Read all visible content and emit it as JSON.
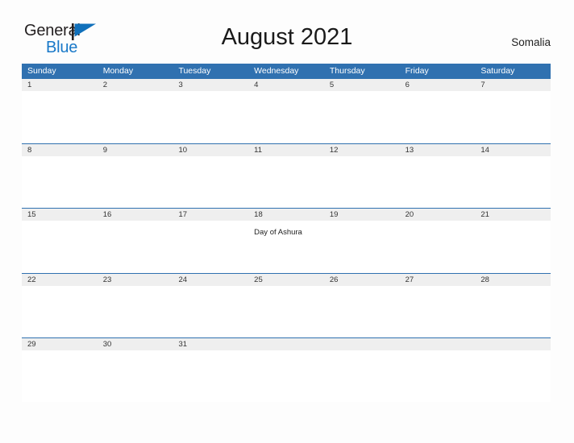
{
  "brand": {
    "name_part1": "General",
    "name_part2": "Blue",
    "flag_icon": "flag-icon",
    "color_dark": "#231f20",
    "color_blue": "#1878c8"
  },
  "header": {
    "title": "August 2021",
    "country": "Somalia"
  },
  "theme": {
    "header_blue": "#3071b0",
    "date_strip_gray": "#efefef",
    "page_background": "#fdfdfd",
    "text_color": "#333333"
  },
  "calendar": {
    "weekdays": [
      "Sunday",
      "Monday",
      "Tuesday",
      "Wednesday",
      "Thursday",
      "Friday",
      "Saturday"
    ],
    "weeks": [
      {
        "days": [
          {
            "num": "1",
            "event": ""
          },
          {
            "num": "2",
            "event": ""
          },
          {
            "num": "3",
            "event": ""
          },
          {
            "num": "4",
            "event": ""
          },
          {
            "num": "5",
            "event": ""
          },
          {
            "num": "6",
            "event": ""
          },
          {
            "num": "7",
            "event": ""
          }
        ]
      },
      {
        "days": [
          {
            "num": "8",
            "event": ""
          },
          {
            "num": "9",
            "event": ""
          },
          {
            "num": "10",
            "event": ""
          },
          {
            "num": "11",
            "event": ""
          },
          {
            "num": "12",
            "event": ""
          },
          {
            "num": "13",
            "event": ""
          },
          {
            "num": "14",
            "event": ""
          }
        ]
      },
      {
        "days": [
          {
            "num": "15",
            "event": ""
          },
          {
            "num": "16",
            "event": ""
          },
          {
            "num": "17",
            "event": ""
          },
          {
            "num": "18",
            "event": "Day of Ashura"
          },
          {
            "num": "19",
            "event": ""
          },
          {
            "num": "20",
            "event": ""
          },
          {
            "num": "21",
            "event": ""
          }
        ]
      },
      {
        "days": [
          {
            "num": "22",
            "event": ""
          },
          {
            "num": "23",
            "event": ""
          },
          {
            "num": "24",
            "event": ""
          },
          {
            "num": "25",
            "event": ""
          },
          {
            "num": "26",
            "event": ""
          },
          {
            "num": "27",
            "event": ""
          },
          {
            "num": "28",
            "event": ""
          }
        ]
      },
      {
        "days": [
          {
            "num": "29",
            "event": ""
          },
          {
            "num": "30",
            "event": ""
          },
          {
            "num": "31",
            "event": ""
          },
          {
            "num": "",
            "event": ""
          },
          {
            "num": "",
            "event": ""
          },
          {
            "num": "",
            "event": ""
          },
          {
            "num": "",
            "event": ""
          }
        ]
      }
    ]
  }
}
